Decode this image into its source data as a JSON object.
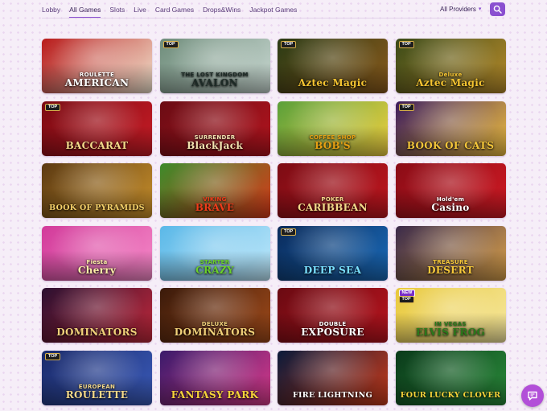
{
  "nav": {
    "items": [
      "Lobby",
      "All Games",
      "Slots",
      "Live",
      "Card Games",
      "Drops&Wins",
      "Jackpot Games"
    ],
    "active": "All Games"
  },
  "filter": {
    "providers_label": "All Providers",
    "chevron": "chevron-down-icon"
  },
  "search": {
    "icon": "search-icon"
  },
  "chat": {
    "icon": "chat-icon"
  },
  "games": [
    {
      "title": "AMERICAN",
      "subtitle": "ROULETTE",
      "badge": "",
      "colors": [
        "#b81a1a",
        "#f2e6d0"
      ],
      "text_color": "#ffffff"
    },
    {
      "title": "AVALON",
      "subtitle": "THE LOST KINGDOM",
      "badge": "TOP",
      "colors": [
        "#6e8c7a",
        "#c9d8d2"
      ],
      "text_color": "#1d2a26"
    },
    {
      "title": "Aztec Magic",
      "subtitle": "",
      "badge": "TOP",
      "colors": [
        "#2a3a14",
        "#8a5a1c"
      ],
      "text_color": "#f5c431"
    },
    {
      "title": "Aztec Magic",
      "subtitle": "Deluxe",
      "badge": "TOP",
      "colors": [
        "#3a4a18",
        "#b68a2a"
      ],
      "text_color": "#f5c431"
    },
    {
      "title": "BACCARAT",
      "subtitle": "",
      "badge": "TOP",
      "colors": [
        "#7a0a12",
        "#c81c26"
      ],
      "text_color": "#f4d98a"
    },
    {
      "title": "BlackJack",
      "subtitle": "SURRENDER",
      "badge": "",
      "colors": [
        "#6a0c14",
        "#b3141e"
      ],
      "text_color": "#f2e2b0"
    },
    {
      "title": "BOB'S",
      "subtitle": "COFFEE SHOP",
      "badge": "",
      "colors": [
        "#5aa03a",
        "#f0d040"
      ],
      "text_color": "#e8a012"
    },
    {
      "title": "BOOK OF CATS",
      "subtitle": "",
      "badge": "TOP",
      "colors": [
        "#3a1a5c",
        "#f0c040"
      ],
      "text_color": "#f4c63a"
    },
    {
      "title": "BOOK OF PYRAMIDS",
      "subtitle": "",
      "badge": "",
      "colors": [
        "#5c3a12",
        "#c8902c"
      ],
      "text_color": "#f6d26a"
    },
    {
      "title": "BRAVE",
      "subtitle": "VIKING",
      "badge": "",
      "colors": [
        "#3c8a2a",
        "#d83a1a"
      ],
      "text_color": "#f03c1a"
    },
    {
      "title": "CARIBBEAN",
      "subtitle": "POKER",
      "badge": "",
      "colors": [
        "#7c0c14",
        "#c0161f"
      ],
      "text_color": "#f4d98a"
    },
    {
      "title": "Casino",
      "subtitle": "Hold'em",
      "badge": "",
      "colors": [
        "#8a0c16",
        "#d01a24"
      ],
      "text_color": "#ffffff"
    },
    {
      "title": "Cherry",
      "subtitle": "Fiesta",
      "badge": "",
      "colors": [
        "#d23a9a",
        "#f58ac8"
      ],
      "text_color": "#fff0a8"
    },
    {
      "title": "CRAZY",
      "subtitle": "STARTER",
      "badge": "",
      "colors": [
        "#5ab8e8",
        "#bfe8fa"
      ],
      "text_color": "#6ad02a"
    },
    {
      "title": "DEEP SEA",
      "subtitle": "",
      "badge": "TOP",
      "colors": [
        "#0a2a5a",
        "#1a6ab8"
      ],
      "text_color": "#7ae0ff"
    },
    {
      "title": "DESERT",
      "subtitle": "TREASURE",
      "badge": "",
      "colors": [
        "#3a2a4a",
        "#d8a04a"
      ],
      "text_color": "#f6c83a"
    },
    {
      "title": "DOMINATORS",
      "subtitle": "",
      "badge": "",
      "colors": [
        "#2a1030",
        "#c0283a"
      ],
      "text_color": "#f2d27a"
    },
    {
      "title": "DOMINATORS",
      "subtitle": "DELUXE",
      "badge": "",
      "colors": [
        "#3a1a0a",
        "#a04a1a"
      ],
      "text_color": "#f2d27a"
    },
    {
      "title": "EXPOSURE",
      "subtitle": "DOUBLE",
      "badge": "",
      "colors": [
        "#6a0a12",
        "#b8141e"
      ],
      "text_color": "#ffffff"
    },
    {
      "title": "ELVIS FROG",
      "subtitle": "IN VEGAS",
      "badge": "NEW",
      "badge2": "TOP",
      "colors": [
        "#e8c83a",
        "#f6e8a0"
      ],
      "text_color": "#2a7a1a"
    },
    {
      "title": "ROULETTE",
      "subtitle": "EUROPEAN",
      "badge": "TOP",
      "colors": [
        "#1a2a6a",
        "#3a5ab8"
      ],
      "text_color": "#f4d98a"
    },
    {
      "title": "FANTASY PARK",
      "subtitle": "",
      "badge": "",
      "colors": [
        "#3a1a6a",
        "#d83a8a"
      ],
      "text_color": "#f6d23a"
    },
    {
      "title": "FIRE LIGHTNING",
      "subtitle": "",
      "badge": "",
      "colors": [
        "#0a1a3a",
        "#c83a1a"
      ],
      "text_color": "#ffffff"
    },
    {
      "title": "FOUR LUCKY CLOVER",
      "subtitle": "",
      "badge": "",
      "colors": [
        "#0a3a1a",
        "#2a8a3a"
      ],
      "text_color": "#f6d23a"
    }
  ]
}
